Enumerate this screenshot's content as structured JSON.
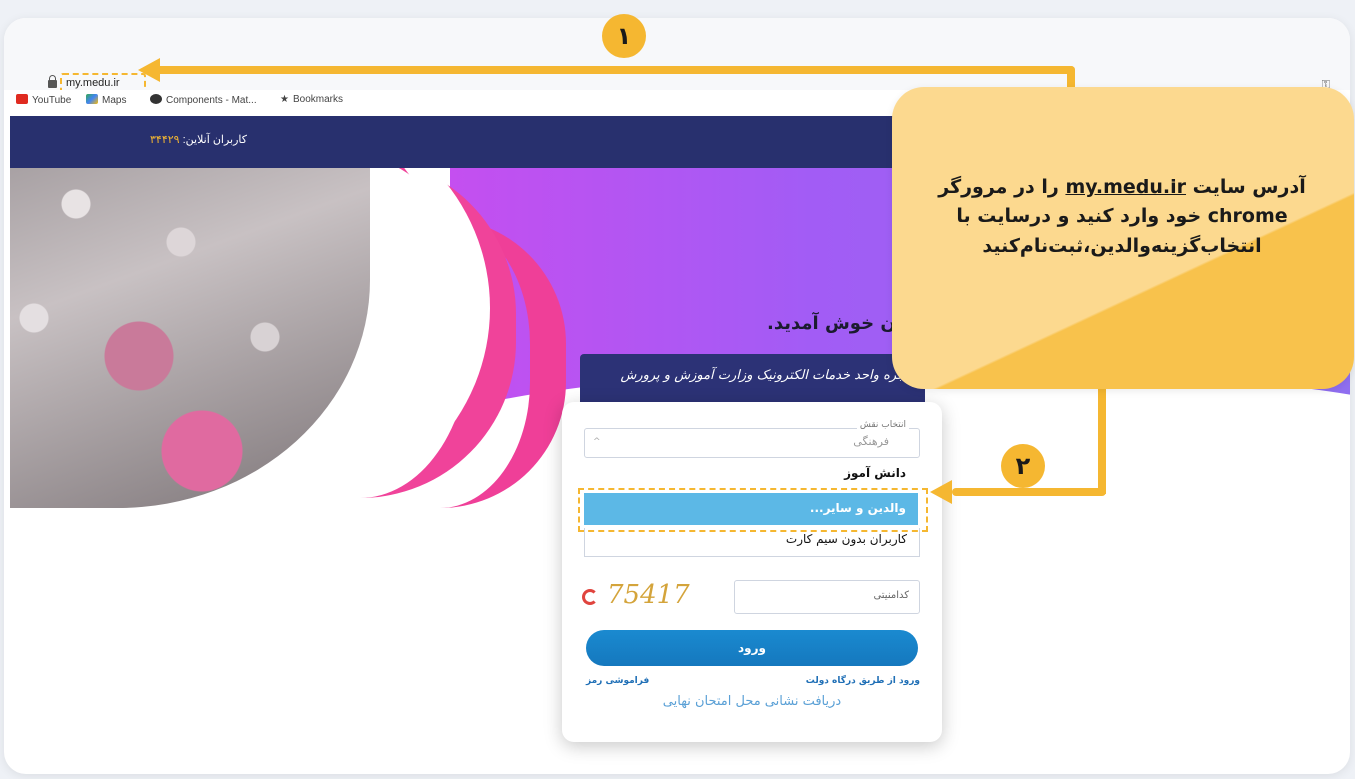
{
  "browser": {
    "url": "my.medu.ir",
    "bookmarks": [
      "YouTube",
      "Maps",
      "Components - Mat...",
      "Bookmarks"
    ]
  },
  "site": {
    "online_label": "کاربران آنلاین:",
    "online_count": "۳۴۴۲۹",
    "welcome": "ن خوش آمدید.",
    "service_title": "پنجره واحد خدمات الکترونیک وزارت آموزش و پرورش"
  },
  "login": {
    "role_legend": "انتخاب نقش",
    "role_selected": "فرهنگی",
    "options": [
      "دانش آموز",
      "والدین و سایر...",
      "کاربران بدون سیم کارت"
    ],
    "captcha": "75417",
    "security_placeholder": "کدامنیتی",
    "login_button": "ورود",
    "gov_link": "ورود از طریق درگاه دولت",
    "forgot_link": "فراموشی رمز",
    "exam_link": "دریافت نشانی محل امتحان نهایی"
  },
  "annotations": {
    "step1": "۱",
    "step2": "۲",
    "callout_part1": "آدرس سایت ",
    "callout_url": "my.medu.ir",
    "callout_part2": " را در مرورگر chrome خود وارد کنید و درسایت با انتخاب‌گزینه‌والدین،ثبت‌نام‌کنید",
    "accent_color": "#f5b731"
  }
}
